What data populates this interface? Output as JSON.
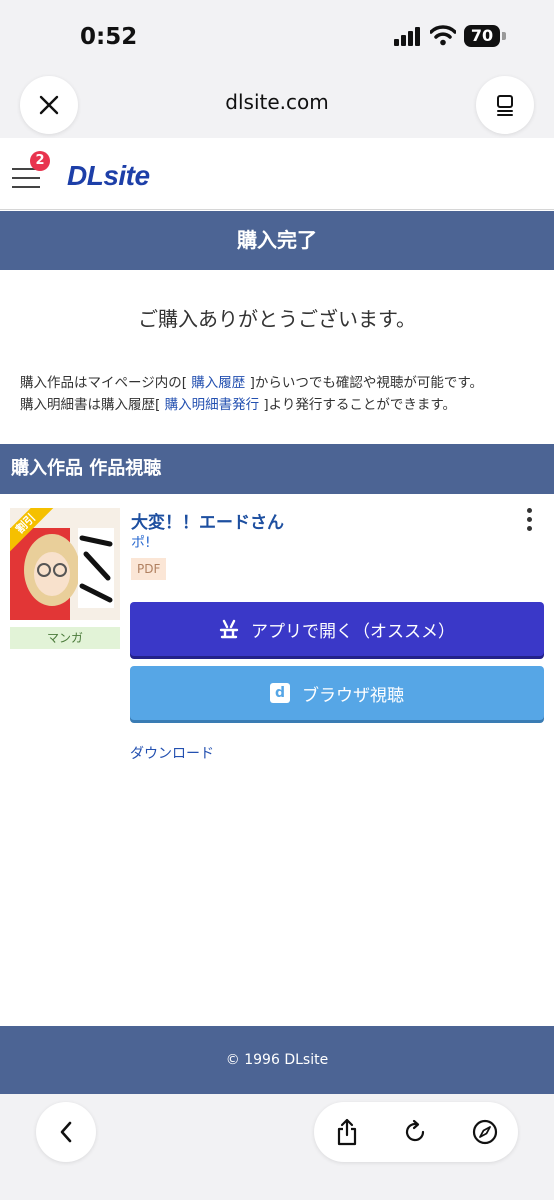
{
  "status": {
    "time": "0:52",
    "battery": "70"
  },
  "browser": {
    "domain": "dlsite.com"
  },
  "site": {
    "menu_badge": "2",
    "logo": "DLsite"
  },
  "page": {
    "title": "購入完了",
    "thanks": "ご購入ありがとうございます。",
    "info_line1_pre": "購入作品はマイページ内の[",
    "info_line1_link": "購入履歴",
    "info_line1_post": "]からいつでも確認や視聴が可能です。",
    "info_line2_pre": "購入明細書は購入履歴[",
    "info_line2_link": "購入明細書発行",
    "info_line2_post": "]より発行することができます。",
    "section_title": "購入作品 作品視聴"
  },
  "product": {
    "sale_label": "割引",
    "title": "大変！！エードさん",
    "circle": "ポ!",
    "format": "PDF",
    "genre": "マンガ",
    "open_app_label": "アプリで開く（オススメ）",
    "browser_label": "ブラウザ視聴",
    "download_label": "ダウンロード"
  },
  "footer": {
    "copyright": "© 1996 DLsite"
  },
  "colors": {
    "header_blue": "#4c6494",
    "app_button": "#3a38c8",
    "browser_button": "#56a6e6",
    "link": "#2350b0",
    "badge": "#e8344e"
  }
}
